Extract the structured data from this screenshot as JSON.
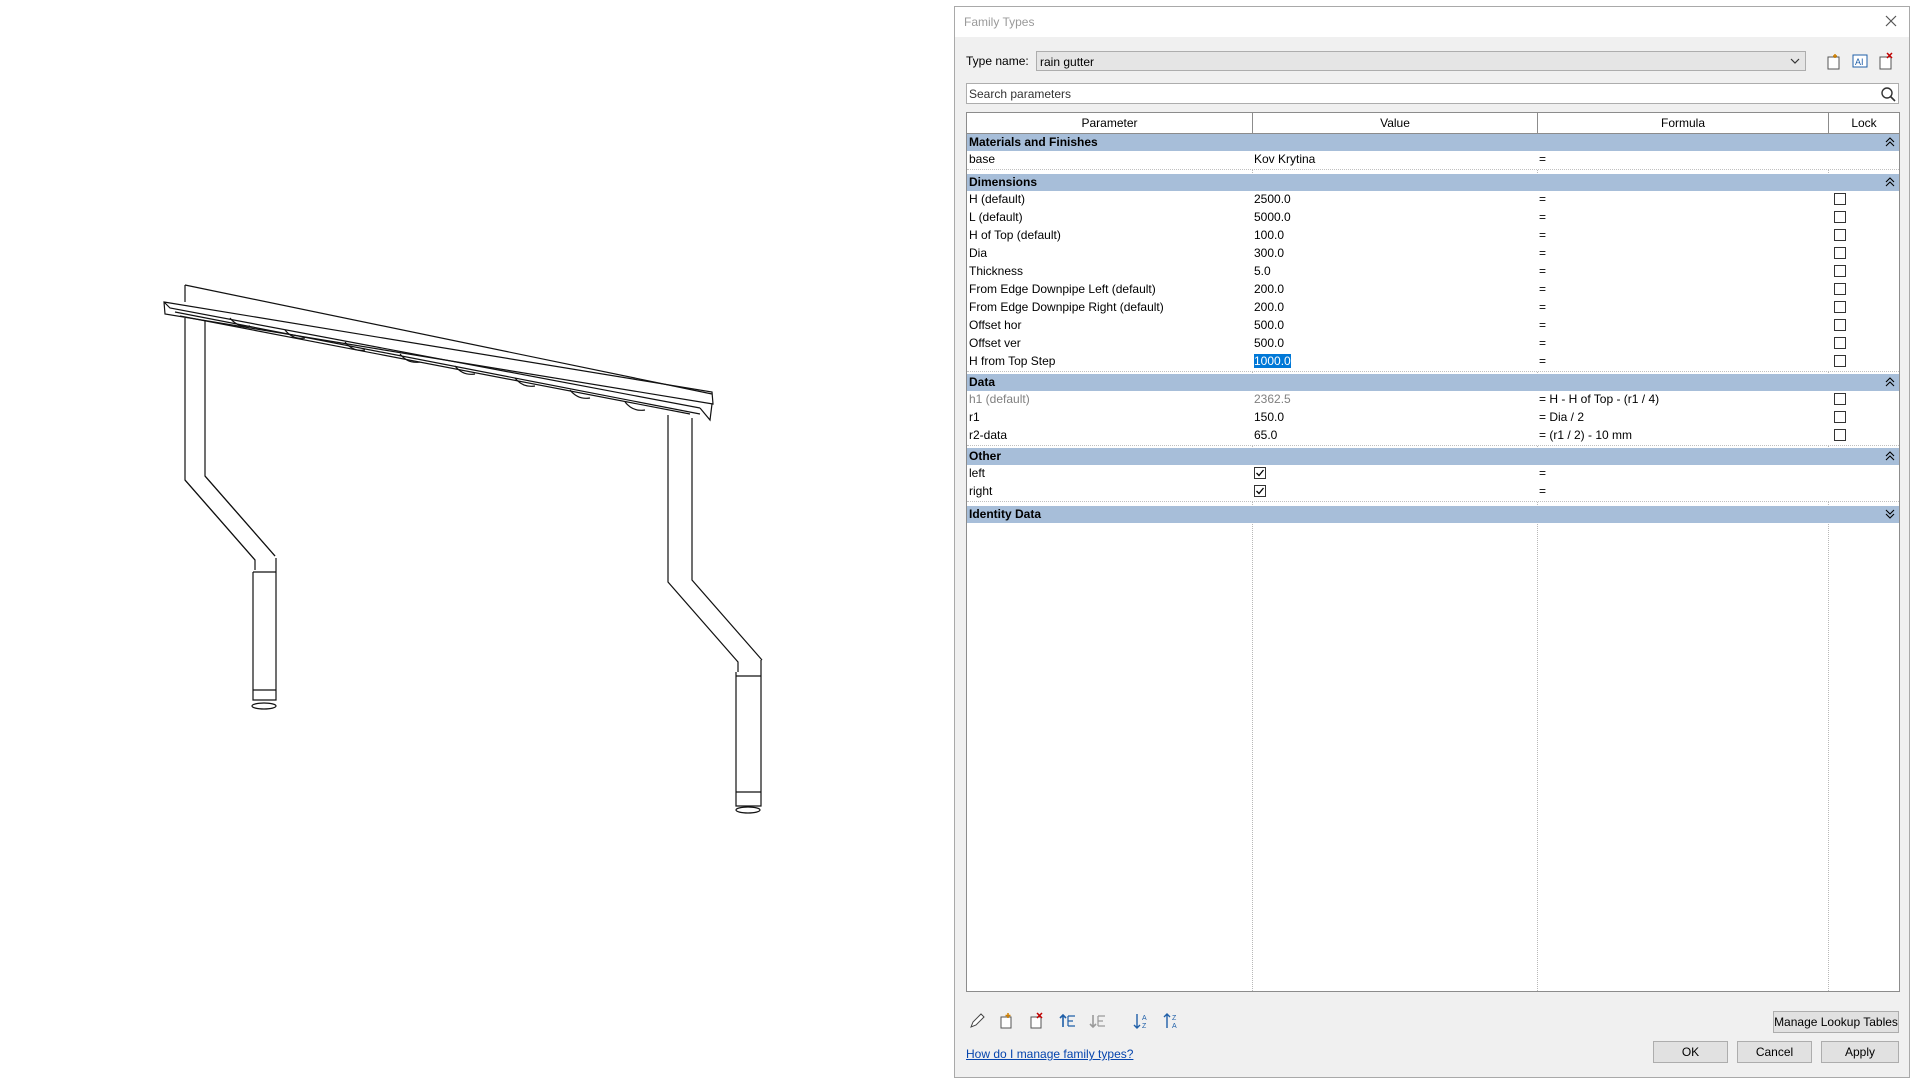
{
  "dialog": {
    "title": "Family Types",
    "type_name_label": "Type name:",
    "type_name_value": "rain gutter",
    "search_placeholder": "Search parameters"
  },
  "columns": [
    "Parameter",
    "Value",
    "Formula",
    "Lock"
  ],
  "groups": [
    {
      "name": "Materials and Finishes",
      "state": "expanded",
      "rows": [
        {
          "param": "base",
          "value": "Kov Krytina",
          "formula": "=",
          "lock": null
        }
      ]
    },
    {
      "name": "Dimensions",
      "state": "expanded",
      "rows": [
        {
          "param": "H (default)",
          "value": "2500.0",
          "formula": "=",
          "lock": false
        },
        {
          "param": "L (default)",
          "value": "5000.0",
          "formula": "=",
          "lock": false
        },
        {
          "param": "H of Top (default)",
          "value": "100.0",
          "formula": "=",
          "lock": false
        },
        {
          "param": "Dia",
          "value": "300.0",
          "formula": "=",
          "lock": false
        },
        {
          "param": "Thickness",
          "value": "5.0",
          "formula": "=",
          "lock": false
        },
        {
          "param": "From Edge Downpipe Left (default)",
          "value": "200.0",
          "formula": "=",
          "lock": false
        },
        {
          "param": "From Edge Downpipe Right (default)",
          "value": "200.0",
          "formula": "=",
          "lock": false
        },
        {
          "param": "Offset hor",
          "value": "500.0",
          "formula": "=",
          "lock": false
        },
        {
          "param": "Offset ver",
          "value": "500.0",
          "formula": "=",
          "lock": false
        },
        {
          "param": "H from Top Step",
          "value": "1000.0",
          "formula": "=",
          "lock": false,
          "selected": true
        }
      ]
    },
    {
      "name": "Data",
      "state": "expanded",
      "rows": [
        {
          "param": "h1 (default)",
          "value": "2362.5",
          "formula": "= H - H of Top - (r1 / 4)",
          "lock": false,
          "readonly": true
        },
        {
          "param": "r1",
          "value": "150.0",
          "formula": "= Dia / 2",
          "lock": false
        },
        {
          "param": "r2-data",
          "value": "65.0",
          "formula": "= (r1 / 2) - 10 mm",
          "lock": false
        }
      ]
    },
    {
      "name": "Other",
      "state": "expanded",
      "rows": [
        {
          "param": "left",
          "value": "checked",
          "formula": "=",
          "lock": null
        },
        {
          "param": "right",
          "value": "checked",
          "formula": "=",
          "lock": null
        }
      ]
    },
    {
      "name": "Identity Data",
      "state": "collapsed",
      "rows": []
    }
  ],
  "footer": {
    "manage_lookup": "Manage Lookup Tables",
    "help_link": "How do I manage family types?",
    "ok": "OK",
    "cancel": "Cancel",
    "apply": "Apply"
  },
  "icons": {
    "toolbar": [
      "new-type-icon",
      "rename-type-icon",
      "delete-type-icon"
    ],
    "bottom": [
      "edit-parameter-icon",
      "new-parameter-icon",
      "delete-parameter-icon",
      "move-up-icon",
      "move-down-icon",
      "sort-ascending-icon",
      "sort-descending-icon"
    ]
  },
  "colors": {
    "group_header": "#a7bed9",
    "selection": "#0078d7"
  }
}
